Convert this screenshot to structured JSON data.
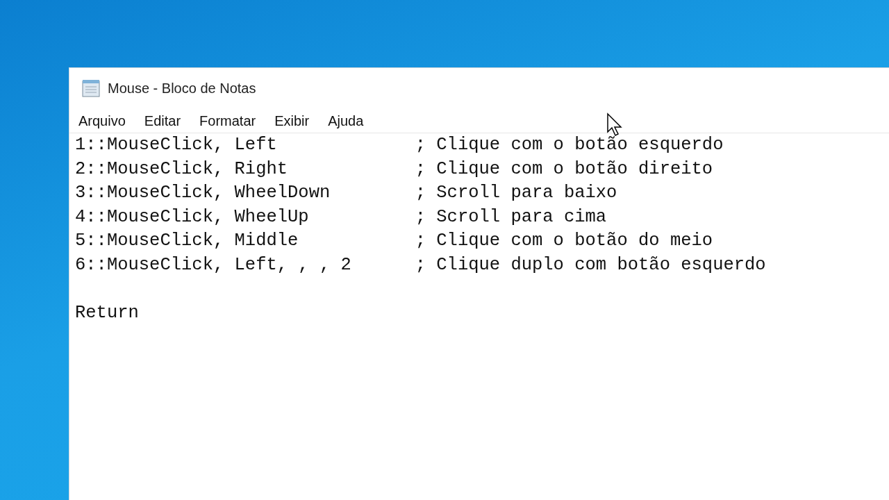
{
  "window": {
    "title": "Mouse - Bloco de Notas"
  },
  "menu": [
    "Arquivo",
    "Editar",
    "Formatar",
    "Exibir",
    "Ajuda"
  ],
  "lines": [
    "1::MouseClick, Left             ; Clique com o botão esquerdo",
    "2::MouseClick, Right            ; Clique com o botão direito",
    "3::MouseClick, WheelDown        ; Scroll para baixo",
    "4::MouseClick, WheelUp          ; Scroll para cima",
    "5::MouseClick, Middle           ; Clique com o botão do meio",
    "6::MouseClick, Left, , , 2      ; Clique duplo com botão esquerdo"
  ],
  "footer": "Return"
}
